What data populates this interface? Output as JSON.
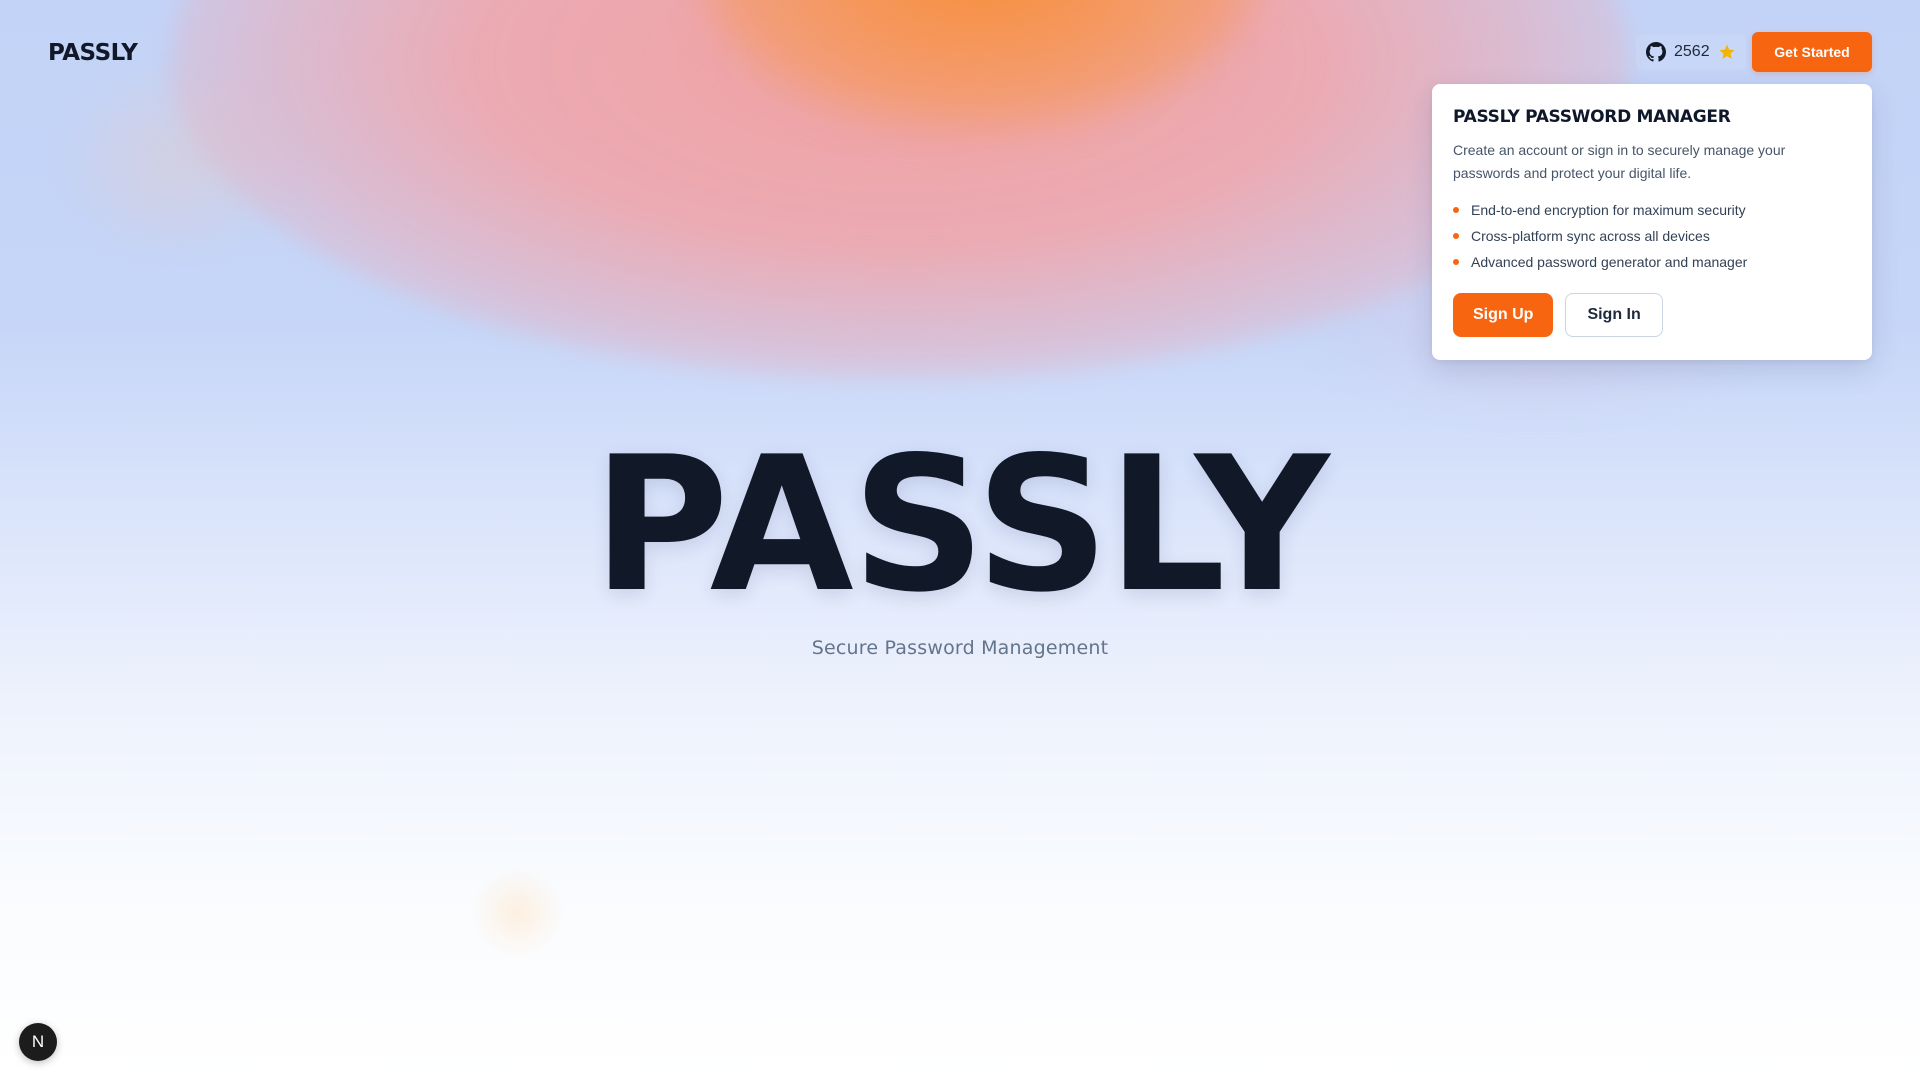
{
  "header": {
    "logo": "PASSLY",
    "github": {
      "icon": "github-icon",
      "stars": "2562",
      "star_icon": "star-icon"
    },
    "cta_label": "Get Started"
  },
  "popover": {
    "title": "PASSLY PASSWORD MANAGER",
    "description": "Create an account or sign in to securely manage your passwords and protect your digital life.",
    "features": [
      "End-to-end encryption for maximum security",
      "Cross-platform sync across all devices",
      "Advanced password generator and manager"
    ],
    "signup_label": "Sign Up",
    "signin_label": "Sign In"
  },
  "hero": {
    "title": "PASSLY",
    "subtitle": "Secure Password Management"
  },
  "devtools": {
    "badge_label": "N"
  },
  "colors": {
    "accent": "#f76511",
    "text_dark": "#111827",
    "subtitle": "#64748b",
    "background_top": "#c3d3f7",
    "blob_orange": "#f88c32",
    "blob_pink": "#f2a0a0",
    "star": "#f5b301"
  }
}
